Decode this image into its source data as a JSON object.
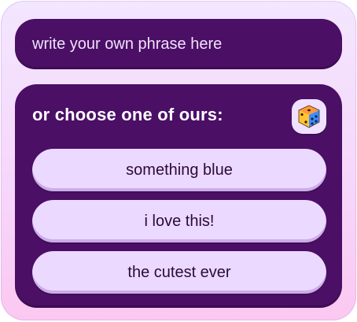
{
  "phrase_input": {
    "placeholder": "write your own phrase here",
    "value": ""
  },
  "choices": {
    "heading": "or choose one of ours:",
    "randomize_icon": "dice-icon",
    "options": [
      {
        "label": "something blue"
      },
      {
        "label": "i love this!"
      },
      {
        "label": "the cutest ever"
      }
    ]
  },
  "colors": {
    "panel": "#4b0f66",
    "option": "#ecd9ff",
    "card_top": "#f3e6ff",
    "card_bottom": "#fbc8f1"
  }
}
